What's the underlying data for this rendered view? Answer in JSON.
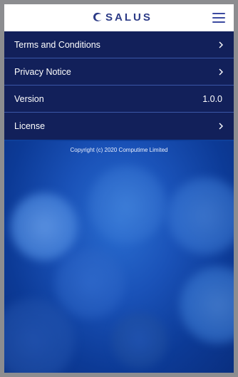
{
  "header": {
    "brand": "SALUS",
    "brand_icon": "salus-swirl-logo",
    "menu_icon": "hamburger-menu-icon"
  },
  "menu": {
    "items": [
      {
        "label": "Terms and Conditions",
        "icon": "chevron-right-icon"
      },
      {
        "label": "Privacy Notice",
        "icon": "chevron-right-icon"
      },
      {
        "label": "Version",
        "value": "1.0.0"
      },
      {
        "label": "License",
        "icon": "chevron-right-icon"
      }
    ]
  },
  "footer": {
    "copyright": "Copyright (c) 2020 Computime Limited"
  },
  "colors": {
    "header_bg": "#ffffff",
    "row_bg": "#12205a",
    "divider": "#3a57a8",
    "background": "#0e3f9a",
    "brand": "#2b3a86"
  }
}
